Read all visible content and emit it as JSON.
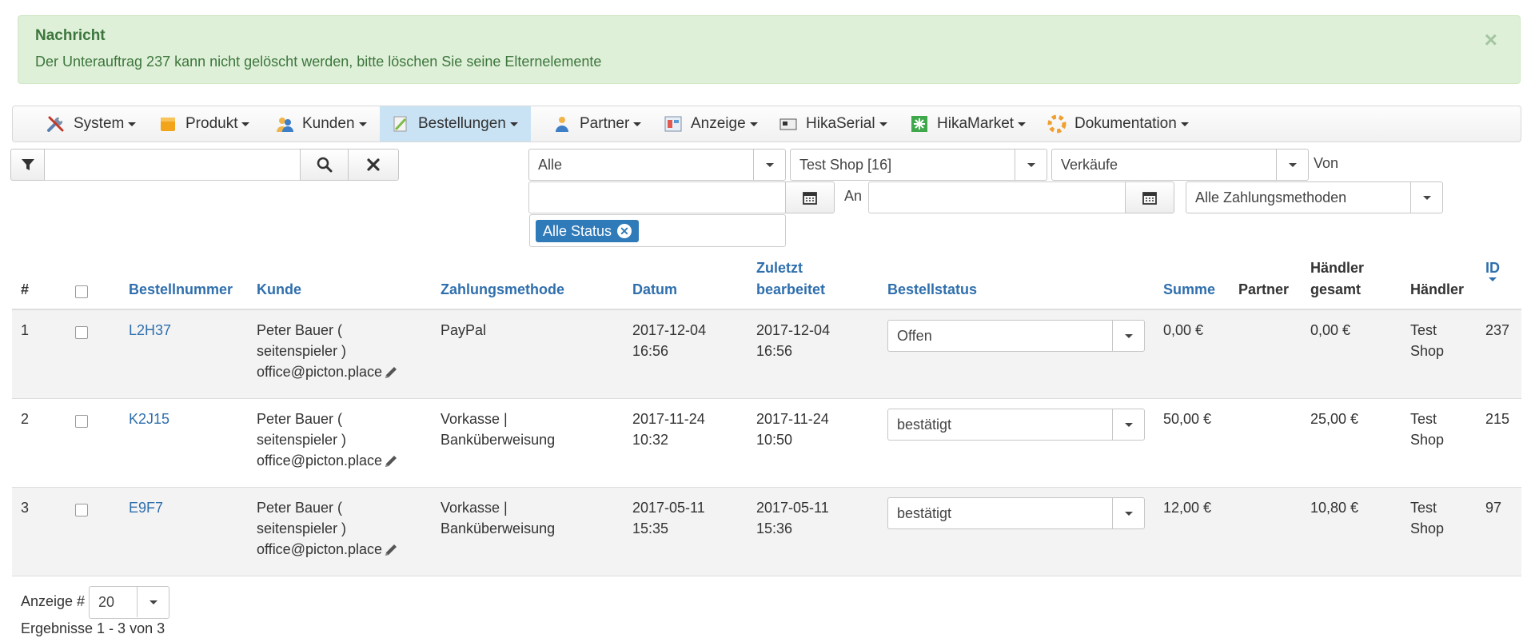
{
  "alert": {
    "title": "Nachricht",
    "message": "Der Unterauftrag 237 kann nicht gelöscht werden, bitte löschen Sie seine Elternelemente",
    "close": "×"
  },
  "menu": [
    {
      "label": "System",
      "icon": "tools-icon"
    },
    {
      "label": "Produkt",
      "icon": "box-icon"
    },
    {
      "label": "Kunden",
      "icon": "users-icon"
    },
    {
      "label": "Bestellungen",
      "icon": "orders-icon"
    },
    {
      "label": "Partner",
      "icon": "partner-icon"
    },
    {
      "label": "Anzeige",
      "icon": "display-icon"
    },
    {
      "label": "HikaSerial",
      "icon": "serial-icon"
    },
    {
      "label": "HikaMarket",
      "icon": "market-icon"
    },
    {
      "label": "Dokumentation",
      "icon": "help-icon"
    }
  ],
  "filters": {
    "search_value": "",
    "status_all": "Alle",
    "shop": "Test Shop [16]",
    "sales": "Verkäufe",
    "from_label": "Von",
    "to_label": "An",
    "payment": "Alle Zahlungsmethoden",
    "status_tag": "Alle Status"
  },
  "table": {
    "headers": {
      "num": "#",
      "order_number": "Bestellnummer",
      "customer": "Kunde",
      "payment": "Zahlungsmethode",
      "date": "Datum",
      "modified_1": "Zuletzt",
      "modified_2": "bearbeitet",
      "status": "Bestellstatus",
      "total": "Summe",
      "partner": "Partner",
      "vendor_total_1": "Händler",
      "vendor_total_2": "gesamt",
      "vendor": "Händler",
      "id": "ID"
    },
    "rows": [
      {
        "num": "1",
        "order": "L2H37",
        "cust1": "Peter Bauer (",
        "cust2": "seitenspieler )",
        "cust3": "office@picton.place",
        "pay1": "PayPal",
        "pay2": "",
        "date1": "2017-12-04",
        "date2": "16:56",
        "mod1": "2017-12-04",
        "mod2": "16:56",
        "status": "Offen",
        "total": "0,00 €",
        "partner": "",
        "vtotal": "0,00 €",
        "vendor1": "Test",
        "vendor2": "Shop",
        "id": "237"
      },
      {
        "num": "2",
        "order": "K2J15",
        "cust1": "Peter Bauer (",
        "cust2": "seitenspieler )",
        "cust3": "office@picton.place",
        "pay1": "Vorkasse |",
        "pay2": "Banküberweisung",
        "date1": "2017-11-24",
        "date2": "10:32",
        "mod1": "2017-11-24",
        "mod2": "10:50",
        "status": "bestätigt",
        "total": "50,00 €",
        "partner": "",
        "vtotal": "25,00 €",
        "vendor1": "Test",
        "vendor2": "Shop",
        "id": "215"
      },
      {
        "num": "3",
        "order": "E9F7",
        "cust1": "Peter Bauer (",
        "cust2": "seitenspieler )",
        "cust3": "office@picton.place",
        "pay1": "Vorkasse |",
        "pay2": "Banküberweisung",
        "date1": "2017-05-11",
        "date2": "15:35",
        "mod1": "2017-05-11",
        "mod2": "15:36",
        "status": "bestätigt",
        "total": "12,00 €",
        "partner": "",
        "vtotal": "10,80 €",
        "vendor1": "Test",
        "vendor2": "Shop",
        "id": "97"
      }
    ]
  },
  "footer": {
    "display_label": "Anzeige #",
    "display_value": "20",
    "results": "Ergebnisse 1 - 3 von 3"
  }
}
